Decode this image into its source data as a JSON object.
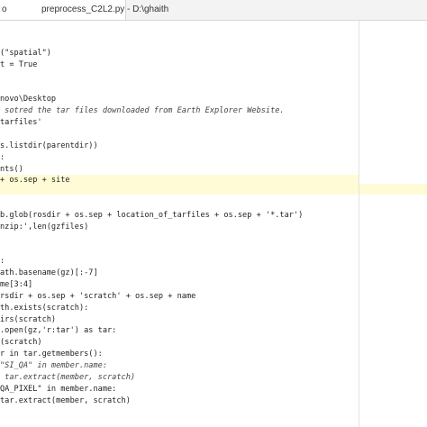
{
  "titlebar": {
    "tab_fragment": "o",
    "title": "preprocess_C2L2.py - D:\\ghaith"
  },
  "code_lines": [
    {
      "text": "(\"spatial\")",
      "style": ""
    },
    {
      "text": "t = True",
      "style": ""
    },
    {
      "text": "",
      "style": ""
    },
    {
      "text": "",
      "style": ""
    },
    {
      "text": "novo\\Desktop",
      "style": ""
    },
    {
      "text": " sotred the tar files downloaded from Earth Explorer Website.",
      "style": "comment"
    },
    {
      "text": "tarfiles'",
      "style": ""
    },
    {
      "text": "",
      "style": ""
    },
    {
      "text": "s.listdir(parentdir))",
      "style": ""
    },
    {
      "text": ":",
      "style": ""
    },
    {
      "text": "nts()",
      "style": ""
    },
    {
      "text": "+ os.sep + site",
      "style": "hl"
    },
    {
      "text": "",
      "style": ""
    },
    {
      "text": "",
      "style": ""
    },
    {
      "text": "b.glob(rosdir + os.sep + location_of_tarfiles + os.sep + '*.tar')",
      "style": ""
    },
    {
      "text": "nzip:',len(gzfiles)",
      "style": ""
    },
    {
      "text": "",
      "style": ""
    },
    {
      "text": "",
      "style": ""
    },
    {
      "text": ":",
      "style": ""
    },
    {
      "text": "ath.basename(gz)[:-7]",
      "style": ""
    },
    {
      "text": "me[3:4]",
      "style": ""
    },
    {
      "text": "rsdir + os.sep + 'scratch' + os.sep + name",
      "style": ""
    },
    {
      "text": "th.exists(scratch):",
      "style": ""
    },
    {
      "text": "irs(scratch)",
      "style": ""
    },
    {
      "text": ".open(gz,'r:tar') as tar:",
      "style": ""
    },
    {
      "text": "(scratch)",
      "style": ""
    },
    {
      "text": "r in tar.getmembers():",
      "style": ""
    },
    {
      "text": "\"SI_QA\" in member.name:",
      "style": "comment"
    },
    {
      "text": " tar.extract(member, scratch)",
      "style": "comment"
    },
    {
      "text": "QA_PIXEL\" in member.name:",
      "style": ""
    },
    {
      "text": "tar.extract(member, scratch)",
      "style": ""
    }
  ]
}
